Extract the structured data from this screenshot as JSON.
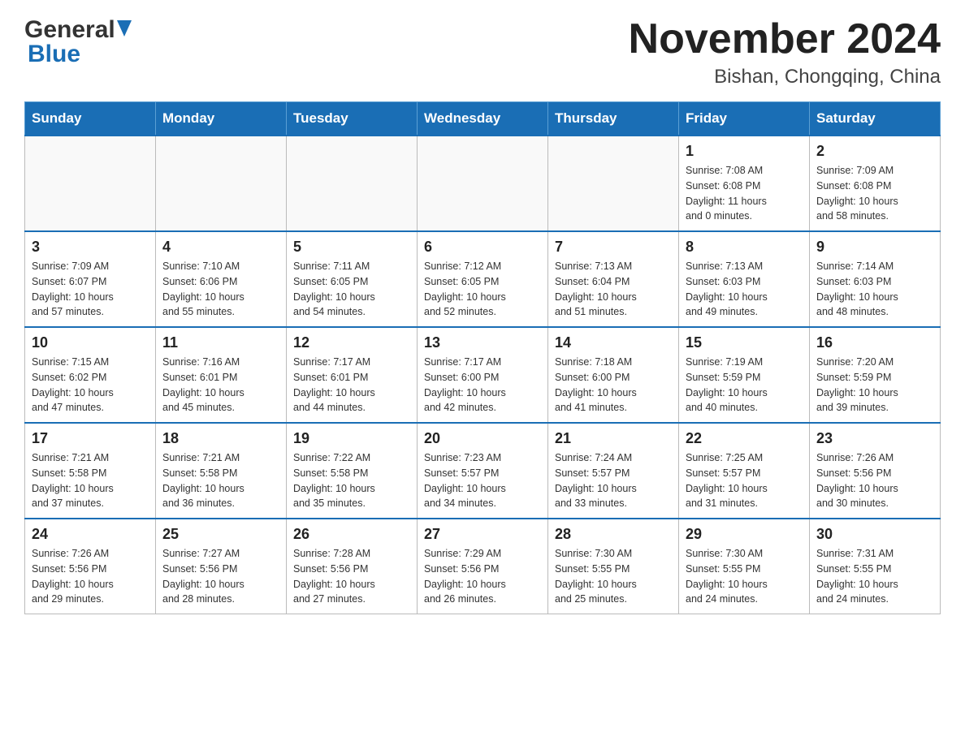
{
  "header": {
    "title": "November 2024",
    "subtitle": "Bishan, Chongqing, China",
    "logo_general": "General",
    "logo_blue": "Blue"
  },
  "days_of_week": [
    "Sunday",
    "Monday",
    "Tuesday",
    "Wednesday",
    "Thursday",
    "Friday",
    "Saturday"
  ],
  "weeks": [
    {
      "days": [
        {
          "number": "",
          "info": ""
        },
        {
          "number": "",
          "info": ""
        },
        {
          "number": "",
          "info": ""
        },
        {
          "number": "",
          "info": ""
        },
        {
          "number": "",
          "info": ""
        },
        {
          "number": "1",
          "info": "Sunrise: 7:08 AM\nSunset: 6:08 PM\nDaylight: 11 hours\nand 0 minutes."
        },
        {
          "number": "2",
          "info": "Sunrise: 7:09 AM\nSunset: 6:08 PM\nDaylight: 10 hours\nand 58 minutes."
        }
      ]
    },
    {
      "days": [
        {
          "number": "3",
          "info": "Sunrise: 7:09 AM\nSunset: 6:07 PM\nDaylight: 10 hours\nand 57 minutes."
        },
        {
          "number": "4",
          "info": "Sunrise: 7:10 AM\nSunset: 6:06 PM\nDaylight: 10 hours\nand 55 minutes."
        },
        {
          "number": "5",
          "info": "Sunrise: 7:11 AM\nSunset: 6:05 PM\nDaylight: 10 hours\nand 54 minutes."
        },
        {
          "number": "6",
          "info": "Sunrise: 7:12 AM\nSunset: 6:05 PM\nDaylight: 10 hours\nand 52 minutes."
        },
        {
          "number": "7",
          "info": "Sunrise: 7:13 AM\nSunset: 6:04 PM\nDaylight: 10 hours\nand 51 minutes."
        },
        {
          "number": "8",
          "info": "Sunrise: 7:13 AM\nSunset: 6:03 PM\nDaylight: 10 hours\nand 49 minutes."
        },
        {
          "number": "9",
          "info": "Sunrise: 7:14 AM\nSunset: 6:03 PM\nDaylight: 10 hours\nand 48 minutes."
        }
      ]
    },
    {
      "days": [
        {
          "number": "10",
          "info": "Sunrise: 7:15 AM\nSunset: 6:02 PM\nDaylight: 10 hours\nand 47 minutes."
        },
        {
          "number": "11",
          "info": "Sunrise: 7:16 AM\nSunset: 6:01 PM\nDaylight: 10 hours\nand 45 minutes."
        },
        {
          "number": "12",
          "info": "Sunrise: 7:17 AM\nSunset: 6:01 PM\nDaylight: 10 hours\nand 44 minutes."
        },
        {
          "number": "13",
          "info": "Sunrise: 7:17 AM\nSunset: 6:00 PM\nDaylight: 10 hours\nand 42 minutes."
        },
        {
          "number": "14",
          "info": "Sunrise: 7:18 AM\nSunset: 6:00 PM\nDaylight: 10 hours\nand 41 minutes."
        },
        {
          "number": "15",
          "info": "Sunrise: 7:19 AM\nSunset: 5:59 PM\nDaylight: 10 hours\nand 40 minutes."
        },
        {
          "number": "16",
          "info": "Sunrise: 7:20 AM\nSunset: 5:59 PM\nDaylight: 10 hours\nand 39 minutes."
        }
      ]
    },
    {
      "days": [
        {
          "number": "17",
          "info": "Sunrise: 7:21 AM\nSunset: 5:58 PM\nDaylight: 10 hours\nand 37 minutes."
        },
        {
          "number": "18",
          "info": "Sunrise: 7:21 AM\nSunset: 5:58 PM\nDaylight: 10 hours\nand 36 minutes."
        },
        {
          "number": "19",
          "info": "Sunrise: 7:22 AM\nSunset: 5:58 PM\nDaylight: 10 hours\nand 35 minutes."
        },
        {
          "number": "20",
          "info": "Sunrise: 7:23 AM\nSunset: 5:57 PM\nDaylight: 10 hours\nand 34 minutes."
        },
        {
          "number": "21",
          "info": "Sunrise: 7:24 AM\nSunset: 5:57 PM\nDaylight: 10 hours\nand 33 minutes."
        },
        {
          "number": "22",
          "info": "Sunrise: 7:25 AM\nSunset: 5:57 PM\nDaylight: 10 hours\nand 31 minutes."
        },
        {
          "number": "23",
          "info": "Sunrise: 7:26 AM\nSunset: 5:56 PM\nDaylight: 10 hours\nand 30 minutes."
        }
      ]
    },
    {
      "days": [
        {
          "number": "24",
          "info": "Sunrise: 7:26 AM\nSunset: 5:56 PM\nDaylight: 10 hours\nand 29 minutes."
        },
        {
          "number": "25",
          "info": "Sunrise: 7:27 AM\nSunset: 5:56 PM\nDaylight: 10 hours\nand 28 minutes."
        },
        {
          "number": "26",
          "info": "Sunrise: 7:28 AM\nSunset: 5:56 PM\nDaylight: 10 hours\nand 27 minutes."
        },
        {
          "number": "27",
          "info": "Sunrise: 7:29 AM\nSunset: 5:56 PM\nDaylight: 10 hours\nand 26 minutes."
        },
        {
          "number": "28",
          "info": "Sunrise: 7:30 AM\nSunset: 5:55 PM\nDaylight: 10 hours\nand 25 minutes."
        },
        {
          "number": "29",
          "info": "Sunrise: 7:30 AM\nSunset: 5:55 PM\nDaylight: 10 hours\nand 24 minutes."
        },
        {
          "number": "30",
          "info": "Sunrise: 7:31 AM\nSunset: 5:55 PM\nDaylight: 10 hours\nand 24 minutes."
        }
      ]
    }
  ]
}
